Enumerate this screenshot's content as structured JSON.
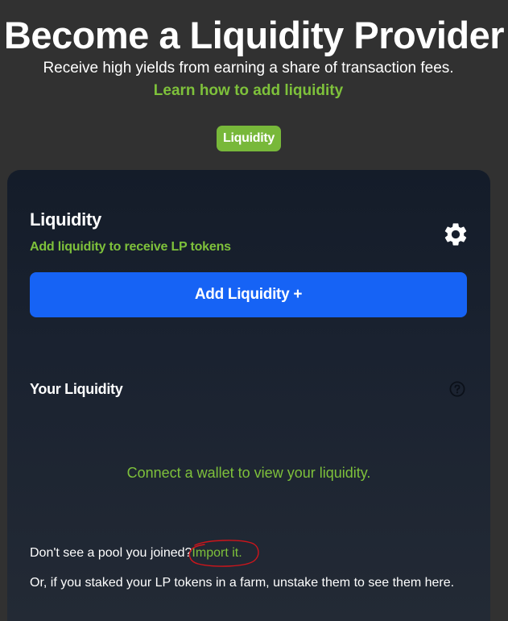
{
  "hero": {
    "title": "Become a Liquidity Provider",
    "subtitle": "Receive high yields from earning a share of transaction fees.",
    "learn_link": "Learn how to add liquidity"
  },
  "tabs": {
    "active_label": "Liquidity"
  },
  "card": {
    "title": "Liquidity",
    "subtitle": "Add liquidity to receive LP tokens",
    "settings_icon": "gear-icon",
    "add_button_label": "Add Liquidity +",
    "your_liquidity_heading": "Your Liquidity",
    "help_icon": "question-circle-icon",
    "connect_message": "Connect a wallet to view your liquidity.",
    "import_prompt": "Don't see a pool you joined?",
    "import_link": "Import it.",
    "farm_note": "Or, if you staked your LP tokens in a farm, unstake them to see them here."
  },
  "colors": {
    "page_background": "#313131",
    "accent_green": "#7ec13b",
    "tab_green": "#78b83a",
    "primary_blue": "#1663f5",
    "card_background": "#1a2230",
    "annotation_red": "#d0151b"
  }
}
